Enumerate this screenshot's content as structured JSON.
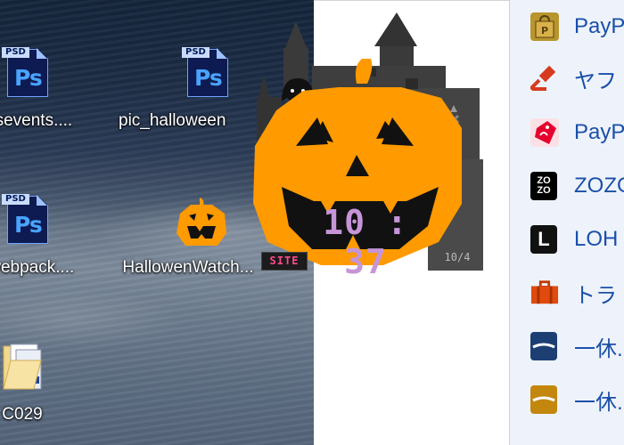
{
  "desktop": {
    "icons": [
      {
        "label": "_fsevents....",
        "type": "PSD"
      },
      {
        "label": "pic_halloween",
        "type": "PSD"
      },
      {
        "label": "_webpack....",
        "type": "PSD"
      },
      {
        "label": "HallowenWatch...",
        "type": "app"
      },
      {
        "label": "C029",
        "type": "folder"
      }
    ],
    "psd_tag": "PSD",
    "ps_glyph": "Ps"
  },
  "widget": {
    "time": "10 : 37",
    "date": "10/4",
    "site_label": "SITE"
  },
  "sidebar": {
    "items": [
      {
        "label": "PayP",
        "icon": "shopping-bag-icon"
      },
      {
        "label": "ヤフ",
        "icon": "auction-hammer-icon"
      },
      {
        "label": "PayP",
        "icon": "paypay-tag-icon"
      },
      {
        "label": "ZOZO",
        "icon": "zozo-icon"
      },
      {
        "label": "LOH",
        "icon": "lohaco-icon"
      },
      {
        "label": "トラ",
        "icon": "suitcase-icon"
      },
      {
        "label": "一休.",
        "icon": "ikyu-icon"
      },
      {
        "label": "一休.",
        "icon": "ikyu-restaurant-icon"
      }
    ],
    "zozo_text": "ZO ZO",
    "lohaco_text": "L"
  },
  "colors": {
    "pumpkin": "#ff9a00",
    "link": "#1a4fa8",
    "clock_digits": "#c695d8"
  }
}
